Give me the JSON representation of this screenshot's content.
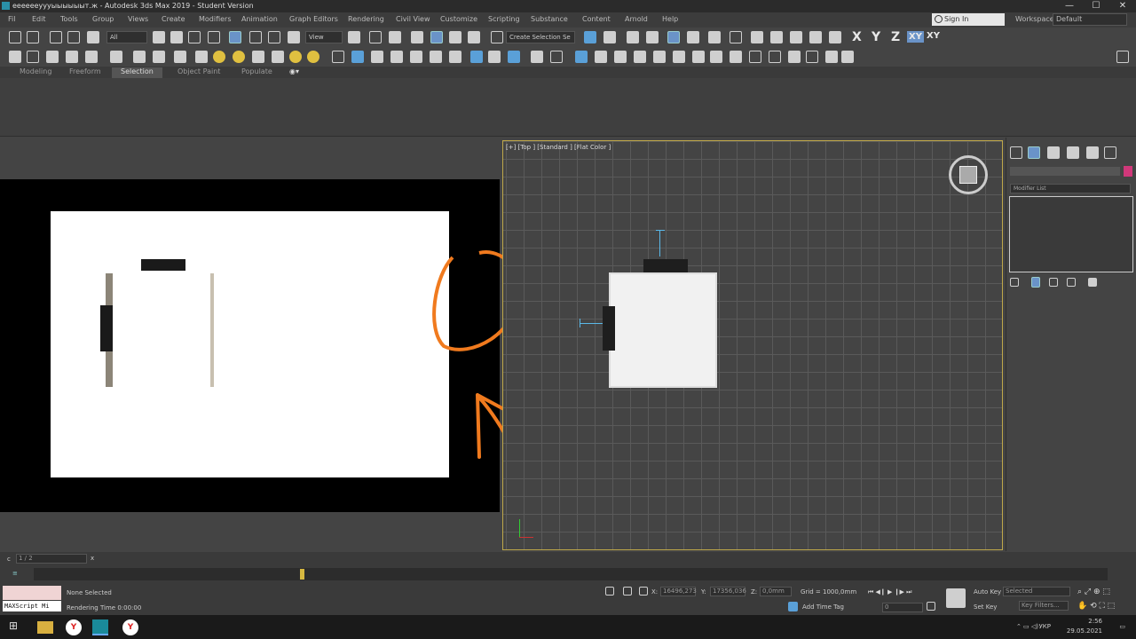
{
  "title_bar": {
    "title": "ееееееуууыыыыыыт.ж - Autodesk 3ds Max 2019 - Student Version",
    "minimize": "—",
    "maximize": "☐",
    "close": "✕"
  },
  "menu": [
    "Fil",
    "Edit",
    "Tools",
    "Group",
    "Views",
    "Create",
    "Modifiers",
    "Animation",
    "Graph Editors",
    "Rendering",
    "Civil View",
    "Customize",
    "Scripting",
    "Substance",
    "Content",
    "Arnold",
    "Help"
  ],
  "signin": {
    "label": "Sign In"
  },
  "workspaces": {
    "label": "Workspaces:",
    "value": "Default"
  },
  "toolbar": {
    "filter_value": "All",
    "view_value": "View",
    "selection_set_placeholder": "Create Selection Se",
    "axis_x": "X",
    "axis_y": "Y",
    "axis_z": "Z",
    "axis_xy": "XY",
    "axis_xy2": "XY"
  },
  "ribbon_tabs": [
    "Modeling",
    "Freeform",
    "Selection",
    "Object Paint",
    "Populate"
  ],
  "active_ribbon_tab": "Selection",
  "viewport_top": {
    "label": "[+] [Top ] [Standard ] [Flat Color ]"
  },
  "command_panel": {
    "modifier_list": "Modifier List",
    "accent_color": "#d0387a"
  },
  "script_listener": {
    "prefix": "c",
    "value": "1 / 2",
    "close": "x"
  },
  "status": {
    "selection": "None Selected",
    "render_time": "Rendering Time  0:00:00",
    "maxscript": "MAXScript Mi",
    "x_label": "X:",
    "x_value": "16496,273",
    "y_label": "Y:",
    "y_value": "17356,036",
    "z_label": "Z:",
    "z_value": "0,0mm",
    "grid": "Grid = 1000,0mm",
    "add_time_tag": "Add Time Tag",
    "auto_key": "Auto Key",
    "set_key": "Set Key",
    "selected": "Selected",
    "key_filters": "Key Filters...",
    "frame": "0"
  },
  "taskbar": {
    "language": "УКР",
    "time": "2:56",
    "date": "29.05.2021"
  }
}
